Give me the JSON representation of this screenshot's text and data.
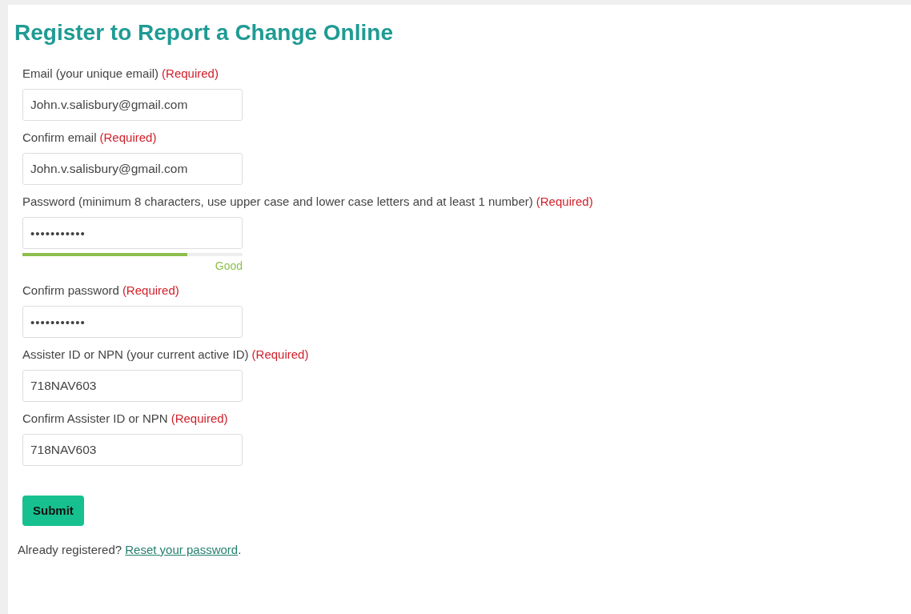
{
  "heading": "Register to Report a Change Online",
  "fields": [
    {
      "label": "Email (your unique email)",
      "required": "(Required)",
      "value": "John.v.salisbury@gmail.com",
      "kind": "text"
    },
    {
      "label": "Confirm email",
      "required": "(Required)",
      "value": "John.v.salisbury@gmail.com",
      "kind": "text"
    },
    {
      "label": "Password (minimum 8 characters, use upper case and lower case letters and at least 1 number)",
      "required": "(Required)",
      "value": "•••••••••••",
      "kind": "password",
      "strength": {
        "level": 0.75,
        "text": "Good"
      }
    },
    {
      "label": "Confirm password",
      "required": "(Required)",
      "value": "•••••••••••",
      "kind": "password"
    },
    {
      "label": "Assister ID or NPN (your current active ID)",
      "required": "(Required)",
      "value": "718NAV603",
      "kind": "text"
    },
    {
      "label": "Confirm Assister ID or NPN",
      "required": "(Required)",
      "value": "718NAV603",
      "kind": "text"
    }
  ],
  "submit": "Submit",
  "footer": {
    "text": "Already registered?",
    "link": "Reset your password",
    "end": "."
  }
}
